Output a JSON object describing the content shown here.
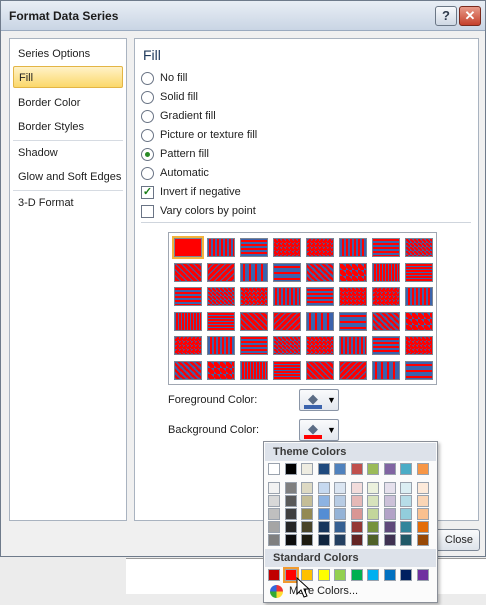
{
  "window": {
    "title": "Format Data Series",
    "help": "?",
    "close": "✕"
  },
  "nav": {
    "items": [
      {
        "label": "Series Options",
        "selected": false
      },
      {
        "label": "Fill",
        "selected": true
      },
      {
        "label": "Border Color",
        "selected": false
      },
      {
        "label": "Border Styles",
        "selected": false
      },
      {
        "label": "Shadow",
        "selected": false
      },
      {
        "label": "Glow and Soft Edges",
        "selected": false
      },
      {
        "label": "3-D Format",
        "selected": false
      }
    ]
  },
  "fill": {
    "heading": "Fill",
    "options": [
      {
        "label": "No fill",
        "selected": false
      },
      {
        "label": "Solid fill",
        "selected": false
      },
      {
        "label": "Gradient fill",
        "selected": false
      },
      {
        "label": "Picture or texture fill",
        "selected": false
      },
      {
        "label": "Pattern fill",
        "selected": true
      },
      {
        "label": "Automatic",
        "selected": false
      }
    ],
    "invert_if_negative": {
      "label": "Invert if negative",
      "checked": true
    },
    "vary_colors": {
      "label": "Vary colors by point",
      "checked": false
    },
    "foreground_label": "Foreground Color:",
    "background_label": "Background Color:",
    "foreground_color": "#3b63ad",
    "background_color": "#ff0000"
  },
  "footer": {
    "close_button": "Close"
  },
  "color_popup": {
    "theme_heading": "Theme Colors",
    "standard_heading": "Standard Colors",
    "more_colors": "More Colors...",
    "theme_top": [
      "#ffffff",
      "#000000",
      "#eeece1",
      "#1f497d",
      "#4f81bd",
      "#c0504d",
      "#9bbb59",
      "#8064a2",
      "#4bacc6",
      "#f79646"
    ],
    "theme_shades": [
      [
        "#f2f2f2",
        "#7f7f7f",
        "#ddd9c3",
        "#c6d9f0",
        "#dbe5f1",
        "#f2dcdb",
        "#ebf1dd",
        "#e5e0ec",
        "#dbeef3",
        "#fdeada"
      ],
      [
        "#d8d8d8",
        "#595959",
        "#c4bd97",
        "#8db3e2",
        "#b8cce4",
        "#e5b9b7",
        "#d7e3bc",
        "#ccc1d9",
        "#b7dde8",
        "#fbd5b5"
      ],
      [
        "#bfbfbf",
        "#3f3f3f",
        "#938953",
        "#548dd4",
        "#95b3d7",
        "#d99694",
        "#c3d69b",
        "#b2a2c7",
        "#92cddc",
        "#fac08f"
      ],
      [
        "#a5a5a5",
        "#262626",
        "#494429",
        "#17365d",
        "#366092",
        "#953734",
        "#76923c",
        "#5f497a",
        "#31859b",
        "#e36c09"
      ],
      [
        "#7f7f7f",
        "#0c0c0c",
        "#1d1b10",
        "#0f243e",
        "#244061",
        "#632423",
        "#4f6128",
        "#3f3151",
        "#205867",
        "#974806"
      ]
    ],
    "standard": [
      "#c00000",
      "#ff0000",
      "#ffc000",
      "#ffff00",
      "#92d050",
      "#00b050",
      "#00b0f0",
      "#0070c0",
      "#002060",
      "#7030a0"
    ],
    "standard_selected_index": 1
  }
}
